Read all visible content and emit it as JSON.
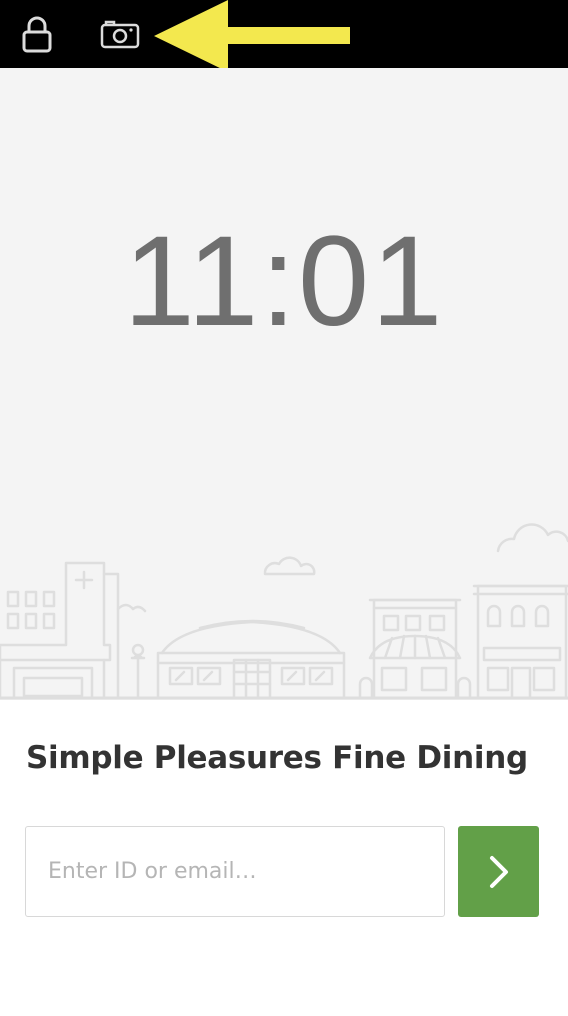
{
  "status_bar": {
    "lock_icon": "lock-icon",
    "camera_icon": "camera-icon",
    "annotation": "yellow-arrow",
    "annotation_color": "#f3e84e"
  },
  "lock_screen": {
    "time": "11:01",
    "illustration": "city-skyline"
  },
  "login": {
    "venue_name": "Simple Pleasures Fine Dining",
    "id_placeholder": "Enter ID or email…",
    "id_value": "",
    "submit_icon": "chevron-right-icon",
    "accent": "#62a048"
  }
}
